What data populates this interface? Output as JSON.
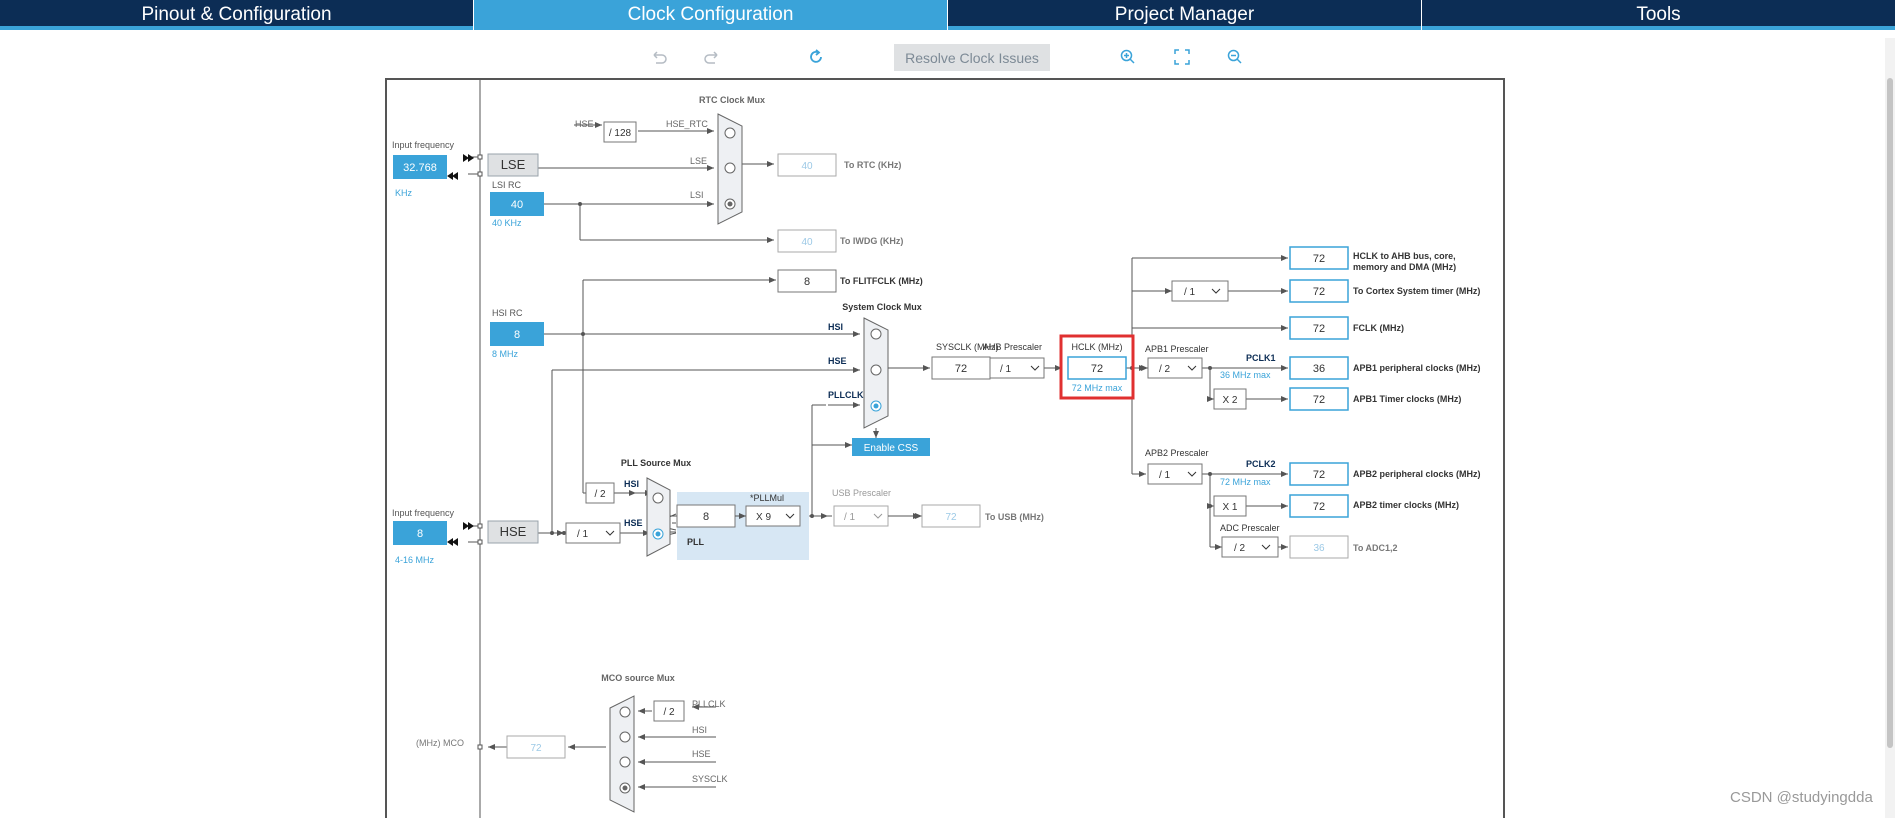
{
  "tabs": [
    "Pinout & Configuration",
    "Clock Configuration",
    "Project Manager",
    "Tools"
  ],
  "toolbar": {
    "resolve_label": "Resolve Clock Issues",
    "icons": [
      "undo-icon",
      "redo-icon",
      "refresh-icon",
      "zoom-in-icon",
      "fit-icon",
      "zoom-out-icon"
    ]
  },
  "colors": {
    "nav": "#0c2d55",
    "accent": "#3aa3d9",
    "highlight": "#e03030"
  },
  "lse": {
    "input_label": "Input frequency",
    "value": "32.768",
    "unit": "KHz",
    "button": "LSE"
  },
  "lsi": {
    "label": "LSI RC",
    "value": "40",
    "unit": "40 KHz"
  },
  "hsi": {
    "label": "HSI RC",
    "value": "8",
    "unit": "8 MHz"
  },
  "hse": {
    "input_label": "Input frequency",
    "value": "8",
    "unit": "4-16 MHz",
    "button": "HSE"
  },
  "rtc": {
    "title": "RTC Clock Mux",
    "hse_label": "HSE",
    "div128": "/ 128",
    "hse_rtc": "HSE_RTC",
    "lse": "LSE",
    "lsi": "LSI",
    "value": "40",
    "out_label": "To RTC (KHz)"
  },
  "iwdg": {
    "value": "40",
    "out_label": "To IWDG (KHz)"
  },
  "flit": {
    "value": "8",
    "out_label": "To FLITFCLK (MHz)"
  },
  "sysmux": {
    "title": "System Clock Mux",
    "hsi": "HSI",
    "hse": "HSE",
    "pllclk": "PLLCLK",
    "css": "Enable CSS"
  },
  "sysclk": {
    "label": "SYSCLK (MHz)",
    "value": "72"
  },
  "ahb": {
    "label": "AHB Prescaler",
    "value": "/ 1"
  },
  "hclk": {
    "label": "HCLK (MHz)",
    "value": "72",
    "max": "72 MHz max"
  },
  "apb1": {
    "label": "APB1 Prescaler",
    "value": "/ 2",
    "pclk": "PCLK1",
    "max": "36 MHz max",
    "x2": "X 2"
  },
  "apb2": {
    "label": "APB2 Prescaler",
    "value": "/ 1",
    "pclk": "PCLK2",
    "max": "72 MHz max",
    "x1": "X 1"
  },
  "adc": {
    "label": "ADC Prescaler",
    "value": "/ 2",
    "out_value": "36",
    "out_label": "To ADC1,2"
  },
  "cortex_div": "/ 1",
  "outputs": [
    {
      "value": "72",
      "label": "HCLK to AHB bus, core,",
      "label2": "memory and DMA (MHz)"
    },
    {
      "value": "72",
      "label": "To Cortex System timer (MHz)"
    },
    {
      "value": "72",
      "label": "FCLK (MHz)"
    },
    {
      "value": "36",
      "label": "APB1 peripheral clocks (MHz)"
    },
    {
      "value": "72",
      "label": "APB1 Timer clocks (MHz)"
    },
    {
      "value": "72",
      "label": "APB2 peripheral clocks (MHz)"
    },
    {
      "value": "72",
      "label": "APB2 timer clocks (MHz)"
    }
  ],
  "pll": {
    "mux_title": "PLL Source Mux",
    "div2": "/ 2",
    "hsi": "HSI",
    "hse": "HSE",
    "hse_div": "/ 1",
    "value": "8",
    "mul_label": "*PLLMul",
    "mul": "X 9",
    "label": "PLL"
  },
  "usb": {
    "label": "USB Prescaler",
    "div": "/ 1",
    "value": "72",
    "out_label": "To USB (MHz)"
  },
  "mco": {
    "title": "MCO source Mux",
    "div2": "/ 2",
    "pllclk": "PLLCLK",
    "hsi": "HSI",
    "hse": "HSE",
    "sysclk": "SYSCLK",
    "value": "72",
    "label": "(MHz) MCO"
  },
  "watermark": "CSDN @studyingdda"
}
